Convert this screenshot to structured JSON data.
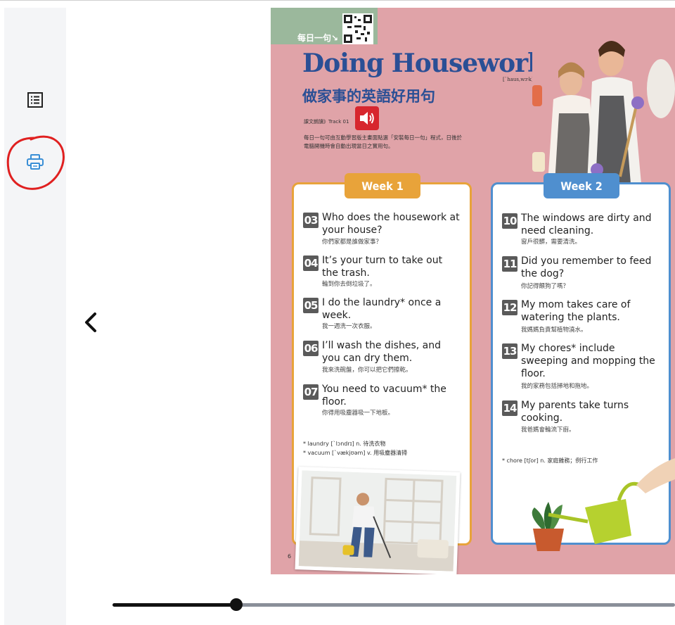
{
  "sidebar": {
    "toc_icon": "list-icon",
    "print_icon": "printer-icon"
  },
  "navigation": {
    "prev_icon": "chevron-left-icon"
  },
  "page": {
    "daily_label": "每日一句↘",
    "title": "Doing Housework",
    "pronunciation": "[ˋhaus,wɝk]",
    "subtitle": "做家事的英語好用句",
    "track_label": "課文朗讀》Track 01",
    "intro": "每日一句可由互動學習版主畫面點選「安裝每日一句」程式，日後於電腦開機時會自動出現當日之實用句。",
    "page_number": "6",
    "week1": {
      "label": "Week 1",
      "sentences": [
        {
          "num": "03",
          "en": "Who does the housework at your house?",
          "zh": "你們家都是誰做家事？"
        },
        {
          "num": "04",
          "en": "It’s your turn to take out the trash.",
          "zh": "輪到你去倒垃圾了。"
        },
        {
          "num": "05",
          "en": "I do the laundry* once a week.",
          "zh": "我一週洗一次衣服。"
        },
        {
          "num": "06",
          "en": "I’ll wash the dishes, and you can dry them.",
          "zh": "我來洗碗盤，你可以把它們擦乾。"
        },
        {
          "num": "07",
          "en": "You need to vacuum* the floor.",
          "zh": "你得用吸塵器吸一下地板。"
        }
      ],
      "gloss1": "* laundry [ˋlɔndrɪ] n. 待洗衣物",
      "gloss2": "* vacuum [ˋvækjʊəm] v. 用吸塵器清掃"
    },
    "week2": {
      "label": "Week 2",
      "sentences": [
        {
          "num": "10",
          "en": "The windows are dirty and need cleaning.",
          "zh": "窗戶很髒，需要清洗。"
        },
        {
          "num": "11",
          "en": "Did you remember to feed the dog?",
          "zh": "你記得餵狗了嗎？"
        },
        {
          "num": "12",
          "en": "My mom takes care of watering the plants.",
          "zh": "我媽媽負責幫植物澆水。"
        },
        {
          "num": "13",
          "en": "My chores* include sweeping and mopping the floor.",
          "zh": "我的家務包括掃地和拖地。"
        },
        {
          "num": "14",
          "en": "My parents take turns cooking.",
          "zh": "我爸媽會輪流下廚。"
        }
      ],
      "gloss1": "* chore [tʃor] n. 家庭雜務；例行工作"
    }
  },
  "slider": {
    "progress": 0.22
  },
  "colors": {
    "page_bg": "#e0a3a8",
    "title_blue": "#2a4f95",
    "week1_orange": "#e8a33a",
    "week2_blue": "#4f8fcf",
    "annotation_red": "#e02020"
  }
}
